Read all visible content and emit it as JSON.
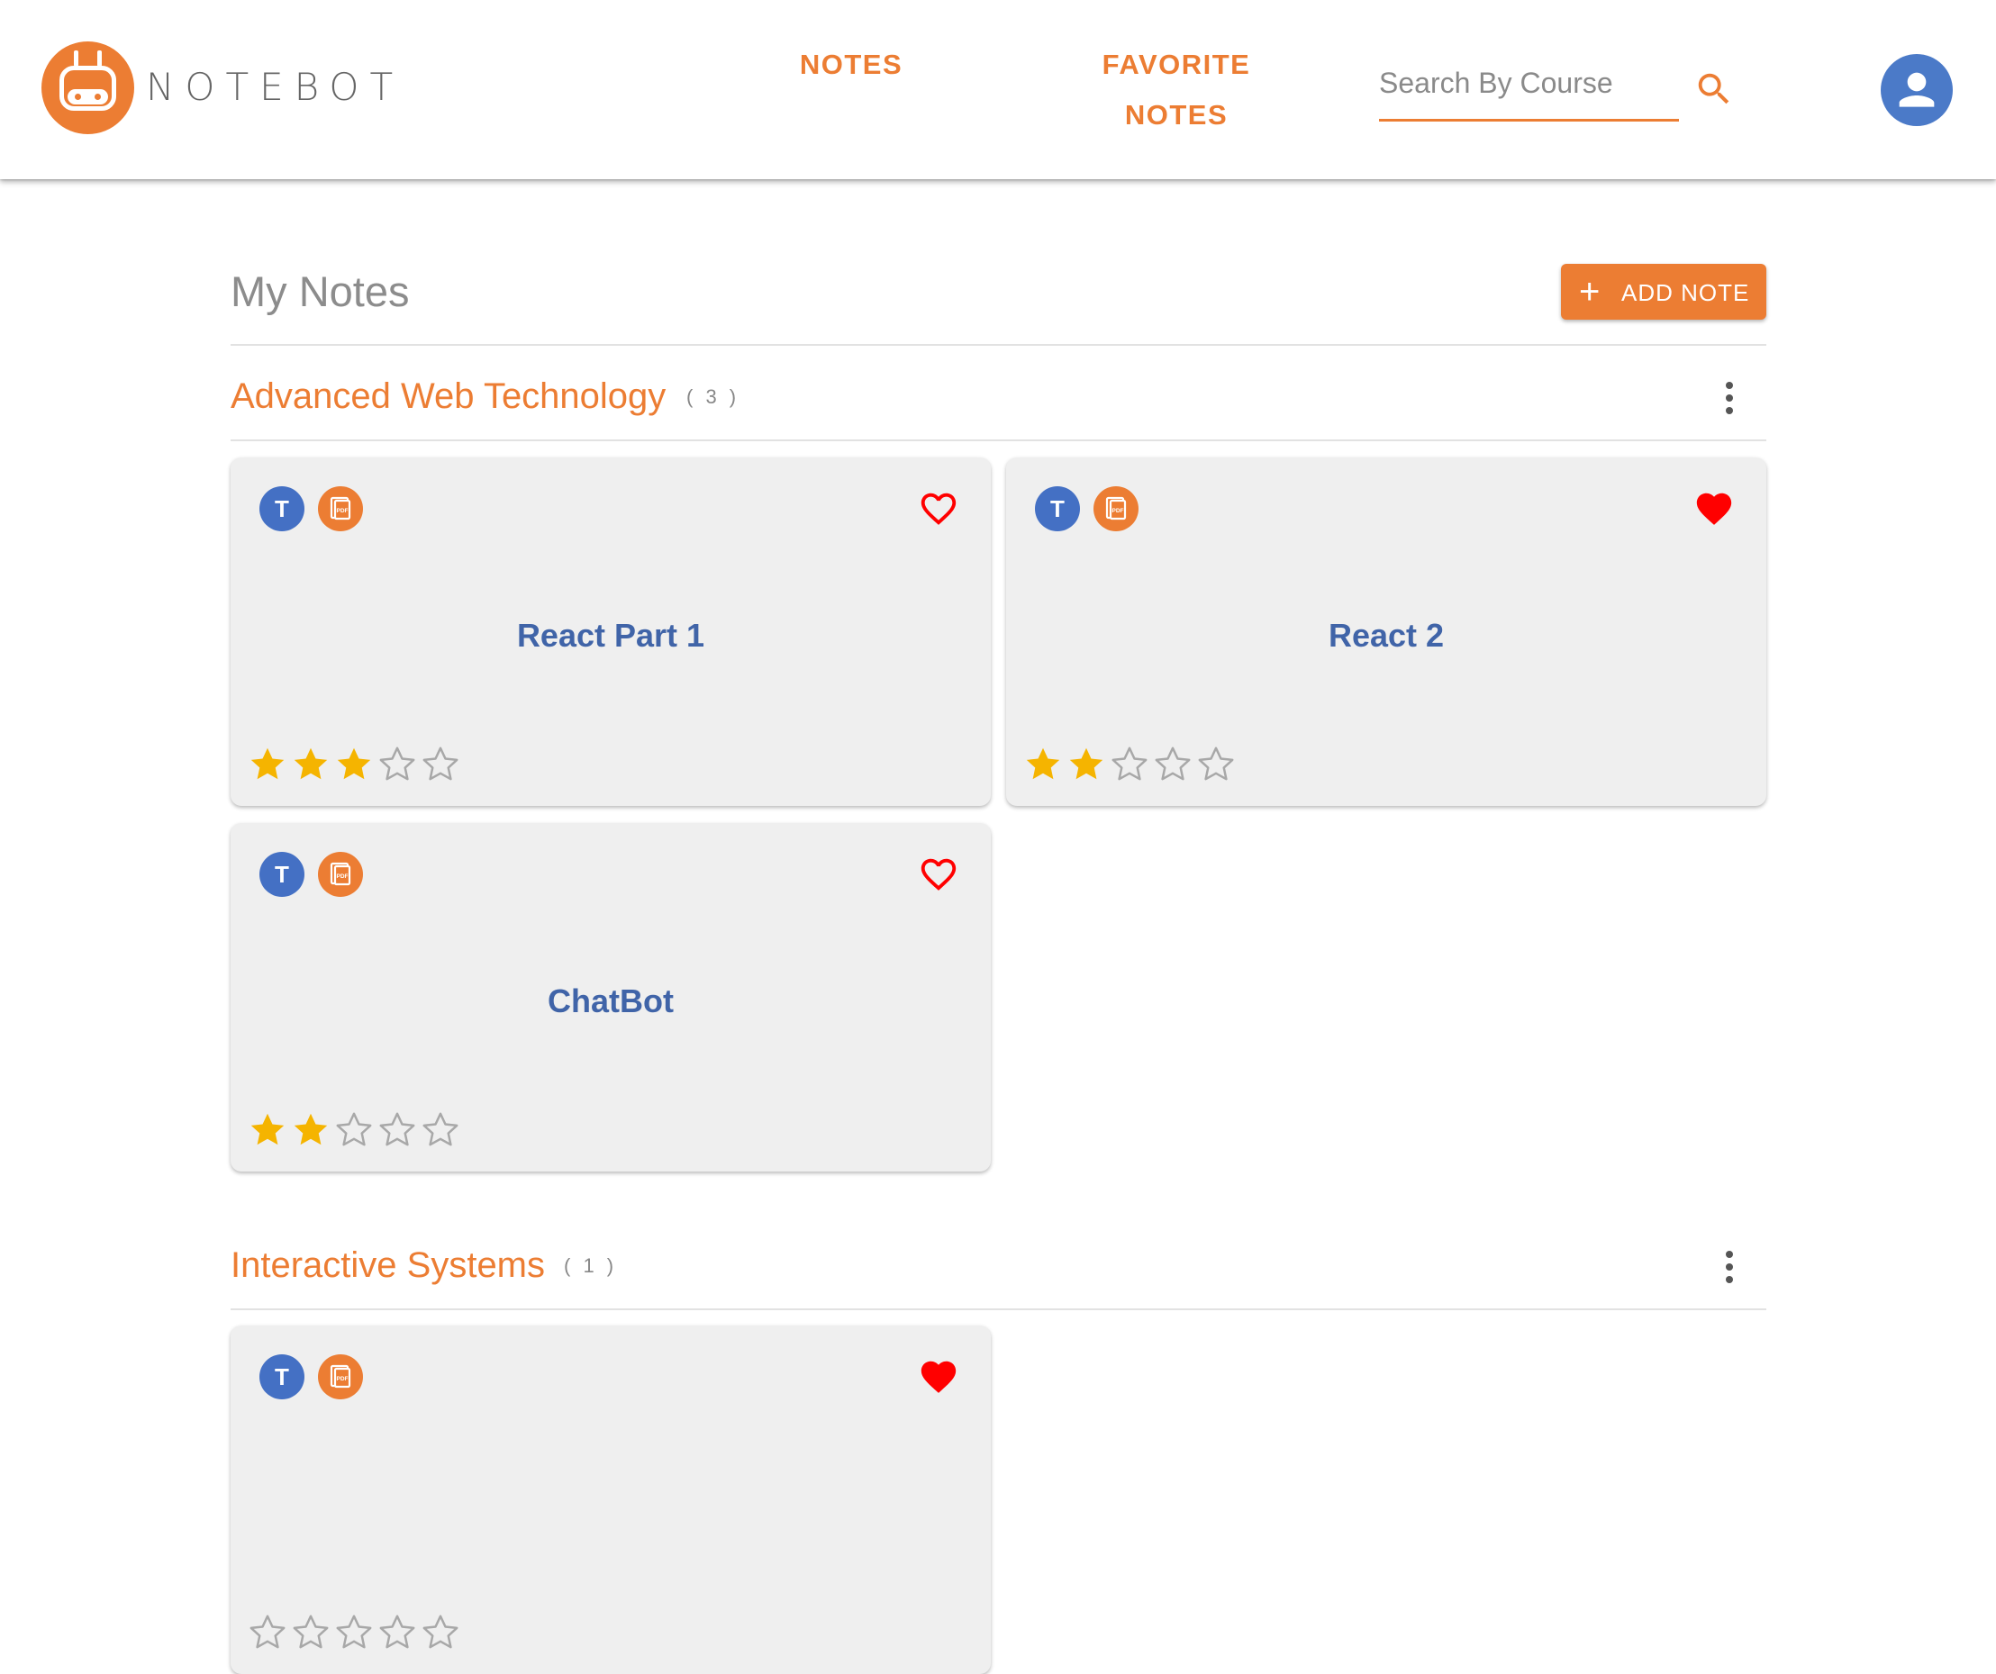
{
  "header": {
    "brand": "NOTEBOT",
    "nav": [
      {
        "label_line1": "NOTES",
        "label_line2": ""
      },
      {
        "label_line1": "FAVORITE",
        "label_line2": "NOTES"
      }
    ],
    "search": {
      "placeholder": "Search By Course",
      "value": ""
    },
    "icons": {
      "search": "search-icon",
      "account": "account-icon",
      "logo": "robot-logo-icon"
    }
  },
  "main": {
    "title": "My Notes",
    "add_button": {
      "icon": "plus-icon",
      "label": "ADD NOTE"
    },
    "courses": [
      {
        "name": "Advanced Web Technology",
        "count": "( 3 )",
        "notes": [
          {
            "badge": "T",
            "file_type": "PDF",
            "title": "React Part 1",
            "favorite": false,
            "rating": 3,
            "max_rating": 5
          },
          {
            "badge": "T",
            "file_type": "PDF",
            "title": "React 2",
            "favorite": true,
            "rating": 2,
            "max_rating": 5
          },
          {
            "badge": "T",
            "file_type": "PDF",
            "title": "ChatBot",
            "favorite": false,
            "rating": 2,
            "max_rating": 5
          }
        ]
      },
      {
        "name": "Interactive Systems",
        "count": "( 1 )",
        "notes": [
          {
            "badge": "T",
            "file_type": "PDF",
            "title": "",
            "favorite": true,
            "rating": 0,
            "max_rating": 5
          }
        ]
      }
    ]
  },
  "colors": {
    "accent": "#ec7d33",
    "badge_blue": "#4470c4",
    "title_blue": "#4064a8",
    "favorite_red": "#ff0000",
    "star_gold": "#f5b400",
    "star_empty": "#a8a8a8",
    "card_bg": "#efefef"
  }
}
